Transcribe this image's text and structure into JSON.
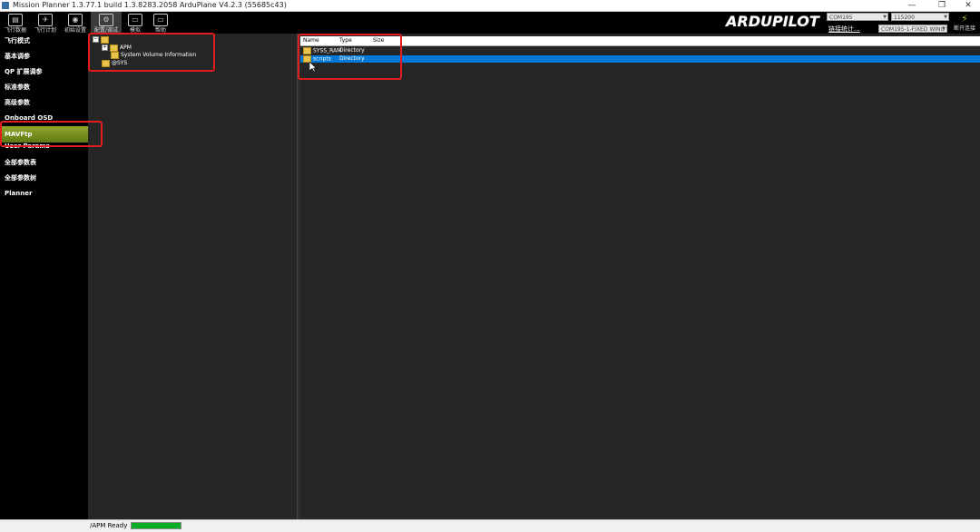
{
  "window": {
    "title": "Mission Planner 1.3.77.1 build 1.3.8283.2058 ArduPlane V4.2.3 (55685c43)",
    "minimize": "—",
    "restore": "❐",
    "close": "✕"
  },
  "toolbar": {
    "buttons": [
      {
        "label": "飞行数据",
        "icon": "flight-data-icon"
      },
      {
        "label": "飞行计划",
        "icon": "flight-plan-icon"
      },
      {
        "label": "初始设置",
        "icon": "initial-setup-icon"
      },
      {
        "label": "配置/调试",
        "icon": "config-tuning-icon"
      },
      {
        "label": "模拟",
        "icon": "simulation-icon"
      },
      {
        "label": "帮助",
        "icon": "help-icon"
      }
    ],
    "logo": "ARDUPILOT",
    "port_combo": "COM195",
    "baud_combo": "115200",
    "link_stats": "链接统计...",
    "vehicle_combo": "COM195-1-FIXED WING",
    "disconnect_label": "断开连接"
  },
  "leftnav": {
    "items": [
      "飞行模式",
      "基本调参",
      "QP 扩展调参",
      "标准参数",
      "高级参数",
      "Onboard OSD",
      "MAVFtp",
      "User Params",
      "全部参数表",
      "全部参数树",
      "Planner"
    ],
    "active_index": 6
  },
  "tree": {
    "root": "",
    "nodes": [
      {
        "label": "APM",
        "expander": "+"
      },
      {
        "label": "System Volume Information",
        "expander": ""
      },
      {
        "label": "@SYS",
        "expander": ""
      }
    ]
  },
  "files": {
    "columns": [
      "Name",
      "Type",
      "Size"
    ],
    "rows": [
      {
        "name": "SYSS_RAM",
        "type": "Directory",
        "size": "",
        "selected": false
      },
      {
        "name": "scripts",
        "type": "Directory",
        "size": "",
        "selected": true
      }
    ]
  },
  "status": {
    "text": "/APM Ready",
    "progress": 1.0
  },
  "colors": {
    "highlight": "#e01e1e",
    "selection": "#0078d7",
    "active_nav": "#7a9420",
    "progress": "#06b025"
  }
}
